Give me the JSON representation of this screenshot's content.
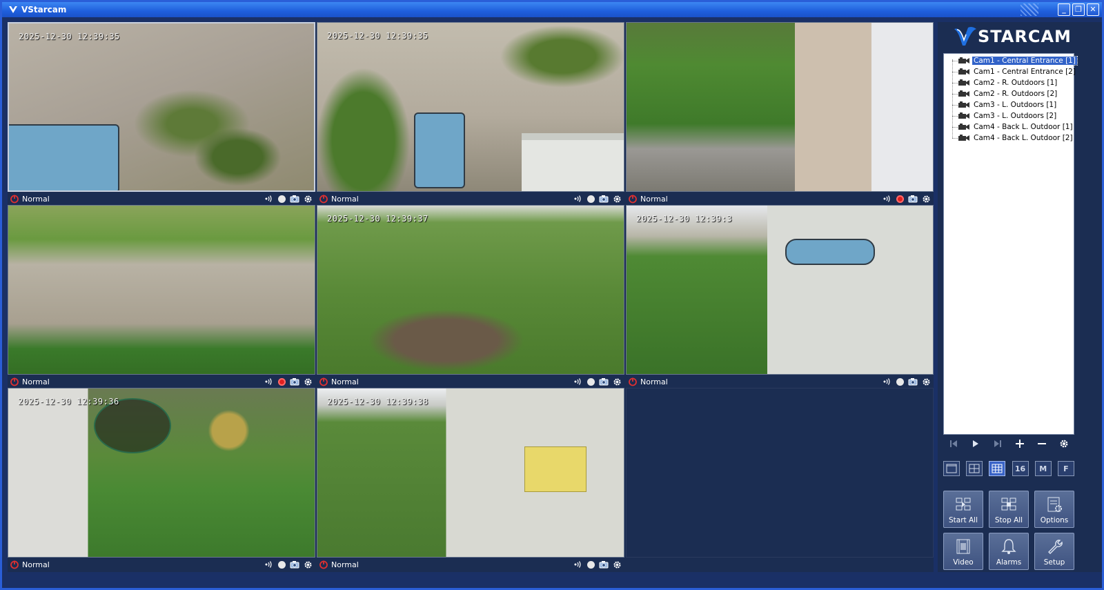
{
  "window": {
    "title": "VStarcam",
    "controls": [
      "minimize",
      "restore",
      "close"
    ]
  },
  "brand": {
    "text": "STARCAM"
  },
  "cameras_tree": [
    {
      "label": "Cam1 - Central Entrance [1]",
      "selected": true
    },
    {
      "label": "Cam1 - Central Entrance [2]",
      "selected": false
    },
    {
      "label": "Cam2 - R. Outdoors [1]",
      "selected": false
    },
    {
      "label": "Cam2 - R. Outdoors [2]",
      "selected": false
    },
    {
      "label": "Cam3 - L. Outdoors [1]",
      "selected": false
    },
    {
      "label": "Cam3 - L. Outdoors [2]",
      "selected": false
    },
    {
      "label": "Cam4 - Back L. Outdoor [1]",
      "selected": false
    },
    {
      "label": "Cam4 - Back L. Outdoor [2]",
      "selected": false
    }
  ],
  "video_cells": [
    {
      "osd": "2025-12-30 12:39:35",
      "status": "Normal",
      "recording": false,
      "selected": true
    },
    {
      "osd": "2025-12-30 12:39:35",
      "status": "Normal",
      "recording": false,
      "selected": false
    },
    {
      "osd": "",
      "status": "Normal",
      "recording": true,
      "selected": false
    },
    {
      "osd": "",
      "status": "Normal",
      "recording": true,
      "selected": false
    },
    {
      "osd": "2025-12-30 12:39:37",
      "status": "Normal",
      "recording": false,
      "selected": false
    },
    {
      "osd": "2025-12-30 12:39:3",
      "status": "Normal",
      "recording": false,
      "selected": false
    },
    {
      "osd": "2025-12-30 12:39:36",
      "status": "Normal",
      "recording": false,
      "selected": false
    },
    {
      "osd": "2025-12-30 12:39:38",
      "status": "Normal",
      "recording": false,
      "selected": false
    },
    {
      "osd": "",
      "status": "",
      "recording": false,
      "selected": false,
      "empty": true
    }
  ],
  "nav_buttons": [
    "first-icon",
    "play-icon",
    "last-icon",
    "add-icon",
    "remove-icon",
    "settings-icon"
  ],
  "layout_buttons": [
    {
      "name": "layout-1",
      "label": "",
      "active": false
    },
    {
      "name": "layout-4",
      "label": "",
      "active": false
    },
    {
      "name": "layout-9",
      "label": "",
      "active": true
    },
    {
      "name": "layout-16",
      "label": "16",
      "active": false
    },
    {
      "name": "layout-m",
      "label": "M",
      "active": false
    },
    {
      "name": "layout-f",
      "label": "F",
      "active": false
    }
  ],
  "actions": [
    {
      "label": "Start All",
      "icon": "start-all-icon"
    },
    {
      "label": "Stop All",
      "icon": "stop-all-icon"
    },
    {
      "label": "Options",
      "icon": "options-icon"
    },
    {
      "label": "Video",
      "icon": "video-icon"
    },
    {
      "label": "Alarms",
      "icon": "bell-icon"
    },
    {
      "label": "Setup",
      "icon": "wrench-icon"
    }
  ],
  "colors": {
    "titlebar": "#1f5fdc",
    "panel_bg": "#1b2d52",
    "tree_selected": "#3162c8",
    "record_active": "#e02020"
  }
}
